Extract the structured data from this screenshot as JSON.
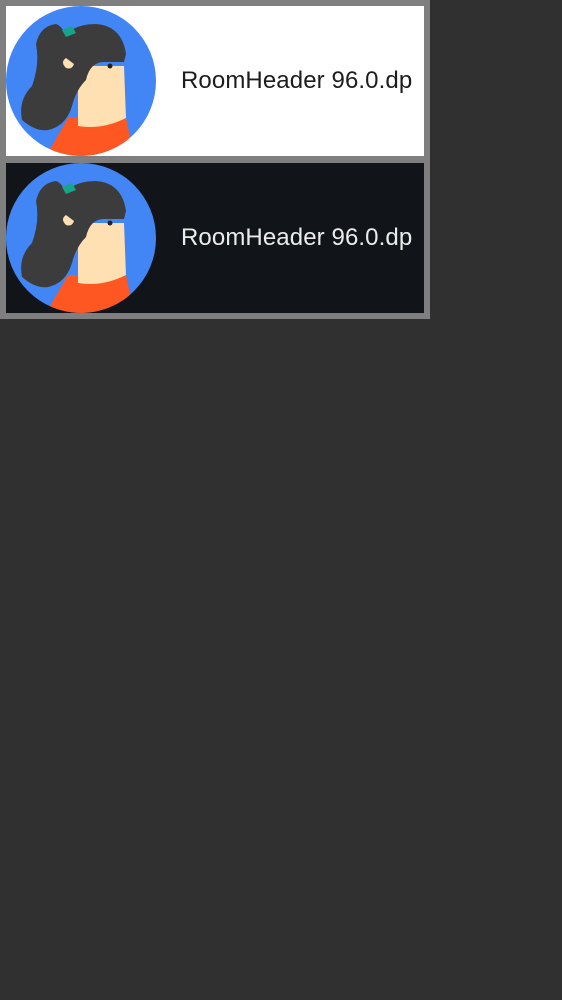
{
  "colors": {
    "frame": "#7f7f7f",
    "background": "#303030",
    "light_row": "#ffffff",
    "dark_row": "#11151a",
    "avatar_blue": "#4285f4",
    "hair": "#3c3c3c",
    "skin": "#ffe0b2",
    "shirt": "#ff5722",
    "hair_clip": "#17a589"
  },
  "rows": [
    {
      "theme": "light",
      "avatar_icon": "person-avatar-icon",
      "label": "RoomHeader 96.0.dp"
    },
    {
      "theme": "dark",
      "avatar_icon": "person-avatar-icon",
      "label": "RoomHeader 96.0.dp"
    }
  ]
}
